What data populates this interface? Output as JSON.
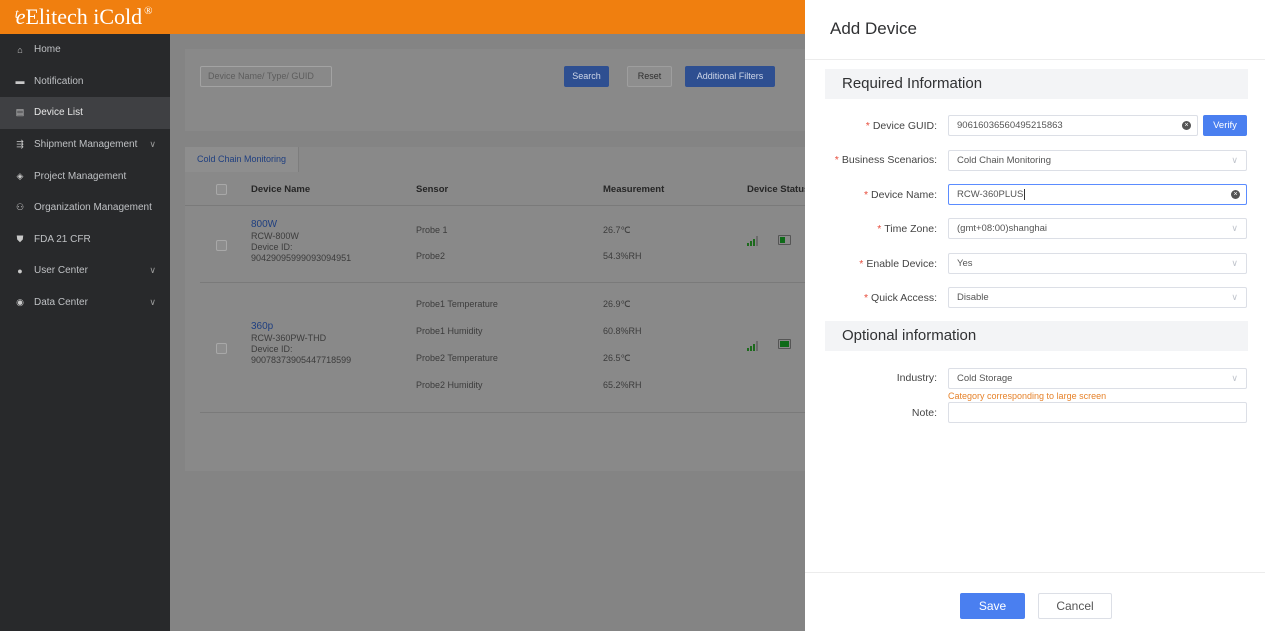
{
  "app": {
    "logo_text": "Elitech iCold",
    "logo_mark": "ᵗe",
    "logo_registered": "®"
  },
  "sidebar": {
    "items": [
      {
        "label": "Home",
        "icon": "home-icon",
        "glyph": "⌂",
        "expandable": false,
        "active": false
      },
      {
        "label": "Notification",
        "icon": "message-icon",
        "glyph": "▬",
        "expandable": false,
        "active": false
      },
      {
        "label": "Device List",
        "icon": "device-icon",
        "glyph": "▤",
        "expandable": false,
        "active": true
      },
      {
        "label": "Shipment Management",
        "icon": "shipment-icon",
        "glyph": "⇶",
        "expandable": true,
        "active": false
      },
      {
        "label": "Project Management",
        "icon": "layers-icon",
        "glyph": "◈",
        "expandable": false,
        "active": false
      },
      {
        "label": "Organization Management",
        "icon": "organization-icon",
        "glyph": "⚇",
        "expandable": false,
        "active": false
      },
      {
        "label": "FDA 21 CFR",
        "icon": "shield-icon",
        "glyph": "⛊",
        "expandable": false,
        "active": false
      },
      {
        "label": "User Center",
        "icon": "user-icon",
        "glyph": "●",
        "expandable": true,
        "active": false
      },
      {
        "label": "Data Center",
        "icon": "data-icon",
        "glyph": "◉",
        "expandable": true,
        "active": false
      }
    ]
  },
  "search": {
    "placeholder": "Device Name/ Type/ GUID",
    "search_label": "Search",
    "reset_label": "Reset",
    "filters_label": "Additional Filters"
  },
  "table": {
    "tab_label": "Cold Chain Monitoring",
    "columns": [
      "Device Name",
      "Sensor",
      "Measurement",
      "Device Status"
    ],
    "rows": [
      {
        "name": "800W",
        "model": "RCW-800W",
        "id_label": "Device ID:",
        "id": "90429095999093094951",
        "sensors": [
          "Probe 1",
          "Probe2"
        ],
        "measurements": [
          "26.7℃",
          "54.3%RH"
        ],
        "signal_level": 3,
        "battery_level": 0.4
      },
      {
        "name": "360p",
        "model": "RCW-360PW-THD",
        "id_label": "Device ID:",
        "id": "90078373905447718599",
        "sensors": [
          "Probe1 Temperature",
          "Probe1 Humidity",
          "Probe2 Temperature",
          "Probe2 Humidity"
        ],
        "measurements": [
          "26.9℃",
          "60.8%RH",
          "26.5℃",
          "65.2%RH"
        ],
        "signal_level": 3,
        "battery_level": 1.0
      }
    ]
  },
  "drawer": {
    "title": "Add Device",
    "required_section": "Required Information",
    "optional_section": "Optional information",
    "fields": {
      "guid": {
        "label": "Device GUID:",
        "value": "90616036560495215863"
      },
      "scenario": {
        "label": "Business Scenarios:",
        "value": "Cold Chain Monitoring"
      },
      "name": {
        "label": "Device Name:",
        "value": "RCW-360PLUS"
      },
      "timezone": {
        "label": "Time Zone:",
        "value": "(gmt+08:00)shanghai"
      },
      "enable": {
        "label": "Enable Device:",
        "value": "Yes"
      },
      "quick": {
        "label": "Quick Access:",
        "value": "Disable"
      },
      "industry": {
        "label": "Industry:",
        "value": "Cold Storage"
      },
      "note": {
        "label": "Note:",
        "value": ""
      }
    },
    "industry_hint": "Category corresponding to large screen",
    "verify_label": "Verify",
    "save_label": "Save",
    "cancel_label": "Cancel",
    "required_mark": "*"
  },
  "colors": {
    "brand_orange": "#f07f0f",
    "primary_blue": "#4a7ff0",
    "required_red": "#e74c3c",
    "hint_orange": "#e6822a"
  }
}
